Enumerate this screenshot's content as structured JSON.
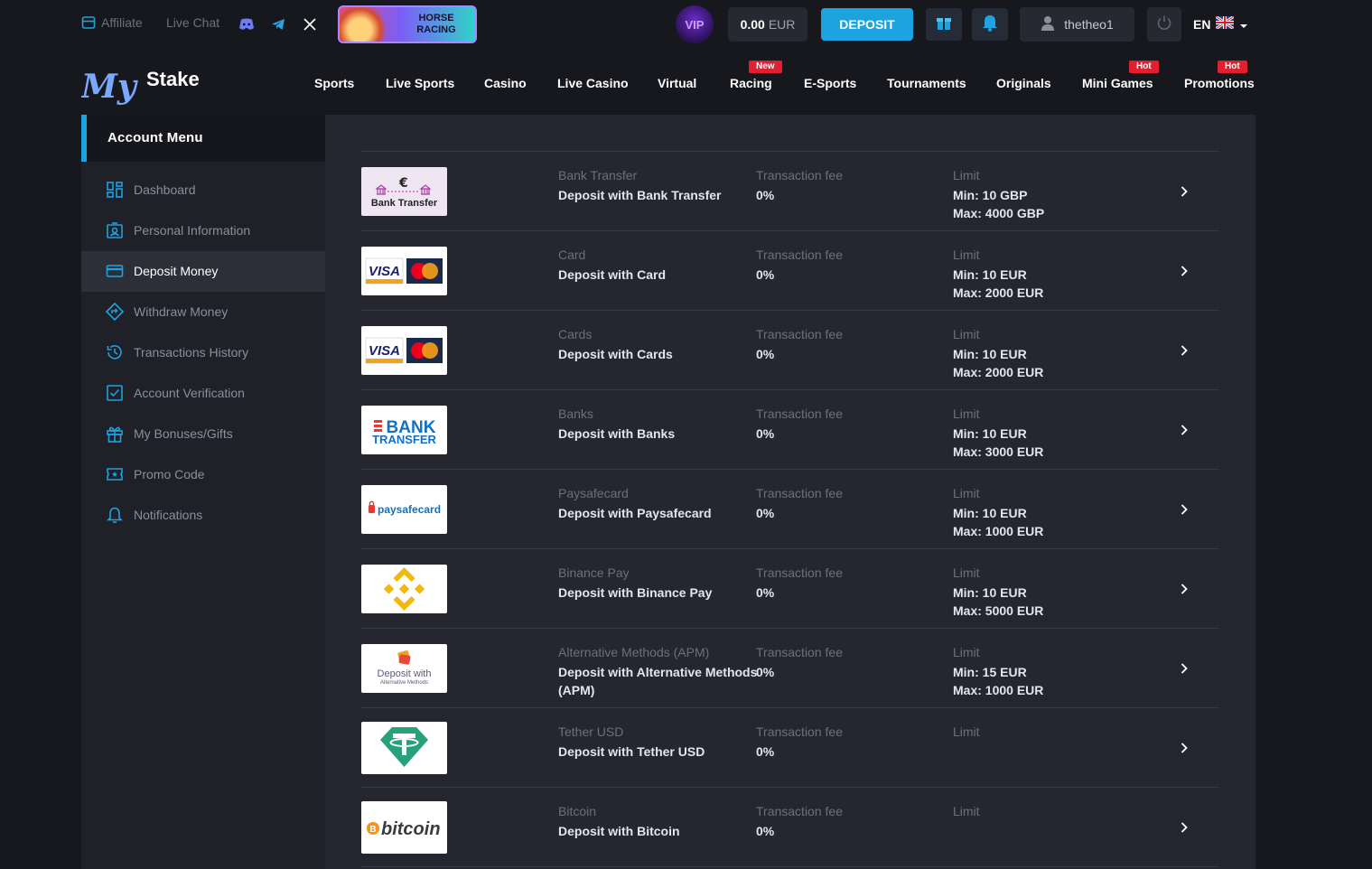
{
  "topbar": {
    "affiliate": "Affiliate",
    "live_chat": "Live Chat",
    "banner_line1": "HORSE",
    "banner_line2": "RACING",
    "vip": "VIP",
    "balance_amount": "0.00",
    "balance_currency": "EUR",
    "deposit": "DEPOSIT",
    "username": "thetheo1",
    "language": "EN"
  },
  "logo": {
    "text_my": "My",
    "text_stake": "Stake"
  },
  "nav": {
    "items": [
      "Sports",
      "Live Sports",
      "Casino",
      "Live Casino",
      "Virtual",
      "Racing",
      "E-Sports",
      "Tournaments",
      "Originals",
      "Mini Games",
      "Promotions"
    ],
    "badges": {
      "racing": "New",
      "mini_games": "Hot",
      "promotions": "Hot"
    }
  },
  "sidebar": {
    "title": "Account Menu",
    "items": [
      {
        "label": "Dashboard",
        "icon": "dashboard-icon"
      },
      {
        "label": "Personal Information",
        "icon": "id-card-icon"
      },
      {
        "label": "Deposit Money",
        "icon": "card-icon"
      },
      {
        "label": "Withdraw Money",
        "icon": "withdraw-icon"
      },
      {
        "label": "Transactions History",
        "icon": "history-icon"
      },
      {
        "label": "Account Verification",
        "icon": "checkbox-icon"
      },
      {
        "label": "My Bonuses/Gifts",
        "icon": "gift-icon"
      },
      {
        "label": "Promo Code",
        "icon": "ticket-icon"
      },
      {
        "label": "Notifications",
        "icon": "bell-icon"
      }
    ]
  },
  "methods": [
    {
      "logo_text": "Bank Transfer",
      "caption": "Bank Transfer",
      "title": "Deposit with Bank Transfer",
      "title2": "",
      "fee_label": "Transaction fee",
      "fee": "0%",
      "limit_label": "Limit",
      "min": "Min: 10 GBP",
      "max": "Max: 4000 GBP"
    },
    {
      "logo_text": "VISA",
      "caption": "Card",
      "title": "Deposit with Card",
      "title2": "",
      "fee_label": "Transaction fee",
      "fee": "0%",
      "limit_label": "Limit",
      "min": "Min: 10 EUR",
      "max": "Max: 2000 EUR"
    },
    {
      "logo_text": "VISA",
      "caption": "Cards",
      "title": "Deposit with Cards",
      "title2": "",
      "fee_label": "Transaction fee",
      "fee": "0%",
      "limit_label": "Limit",
      "min": "Min: 10 EUR",
      "max": "Max: 2000 EUR"
    },
    {
      "logo_text": "BANK TRANSFER",
      "caption": "Banks",
      "title": "Deposit with Banks",
      "title2": "",
      "fee_label": "Transaction fee",
      "fee": "0%",
      "limit_label": "Limit",
      "min": "Min: 10 EUR",
      "max": "Max: 3000 EUR"
    },
    {
      "logo_text": "paysafecard",
      "caption": "Paysafecard",
      "title": "Deposit with Paysafecard",
      "title2": "",
      "fee_label": "Transaction fee",
      "fee": "0%",
      "limit_label": "Limit",
      "min": "Min: 10 EUR",
      "max": "Max: 1000 EUR"
    },
    {
      "logo_text": "",
      "caption": "Binance Pay",
      "title": "Deposit with Binance Pay",
      "title2": "",
      "fee_label": "Transaction fee",
      "fee": "0%",
      "limit_label": "Limit",
      "min": "Min: 10 EUR",
      "max": "Max: 5000 EUR"
    },
    {
      "logo_text": "Deposit with Alternative Methods",
      "caption": "Alternative Methods (APM)",
      "title": "Deposit with Alternative Methods",
      "title2": "(APM)",
      "fee_label": "Transaction fee",
      "fee": "0%",
      "limit_label": "Limit",
      "min": "Min: 15 EUR",
      "max": "Max: 1000 EUR"
    },
    {
      "logo_text": "",
      "caption": "Tether USD",
      "title": "Deposit with Tether USD",
      "title2": "",
      "fee_label": "Transaction fee",
      "fee": "0%",
      "limit_label": "Limit",
      "min": "",
      "max": ""
    },
    {
      "logo_text": "bitcoin",
      "caption": "Bitcoin",
      "title": "Deposit with Bitcoin",
      "title2": "",
      "fee_label": "Transaction fee",
      "fee": "0%",
      "limit_label": "Limit",
      "min": "",
      "max": ""
    }
  ],
  "colors": {
    "accent": "#1ca3e0",
    "badge": "#e0202e",
    "bg": "#17181e",
    "panel": "#252630"
  }
}
